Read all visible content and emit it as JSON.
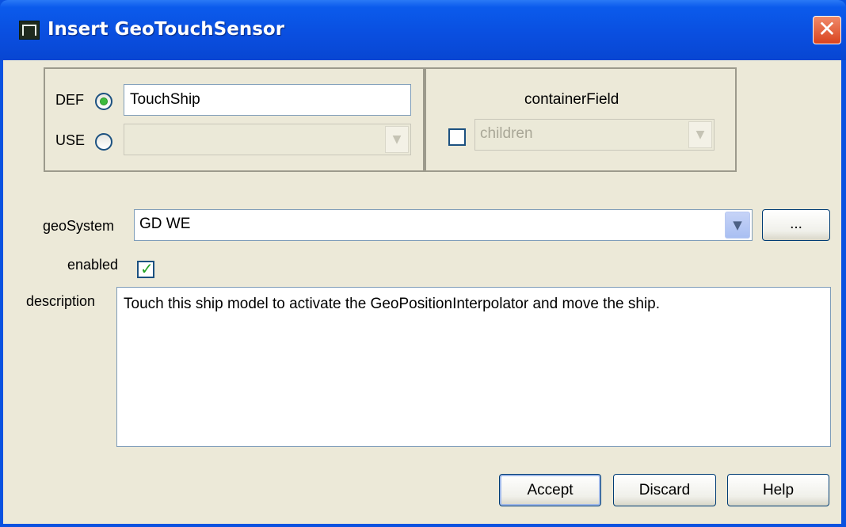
{
  "window": {
    "title": "Insert GeoTouchSensor",
    "close_symbol": "✕"
  },
  "def_use": {
    "def_label": "DEF",
    "use_label": "USE",
    "def_selected": true,
    "def_value": "TouchShip",
    "use_value": ""
  },
  "container_field": {
    "heading": "containerField",
    "value": "children",
    "checked": false
  },
  "geo_system": {
    "label": "geoSystem",
    "value": "GD WE",
    "browse_label": "..."
  },
  "enabled": {
    "label": "enabled",
    "checked": true
  },
  "description": {
    "label": "description",
    "value": "Touch this ship model to activate the GeoPositionInterpolator and move the ship."
  },
  "buttons": {
    "accept": "Accept",
    "discard": "Discard",
    "help": "Help"
  },
  "icons": {
    "app": "x3d-edit-icon",
    "dropdown": "chevron-down-icon",
    "check": "check-icon"
  }
}
